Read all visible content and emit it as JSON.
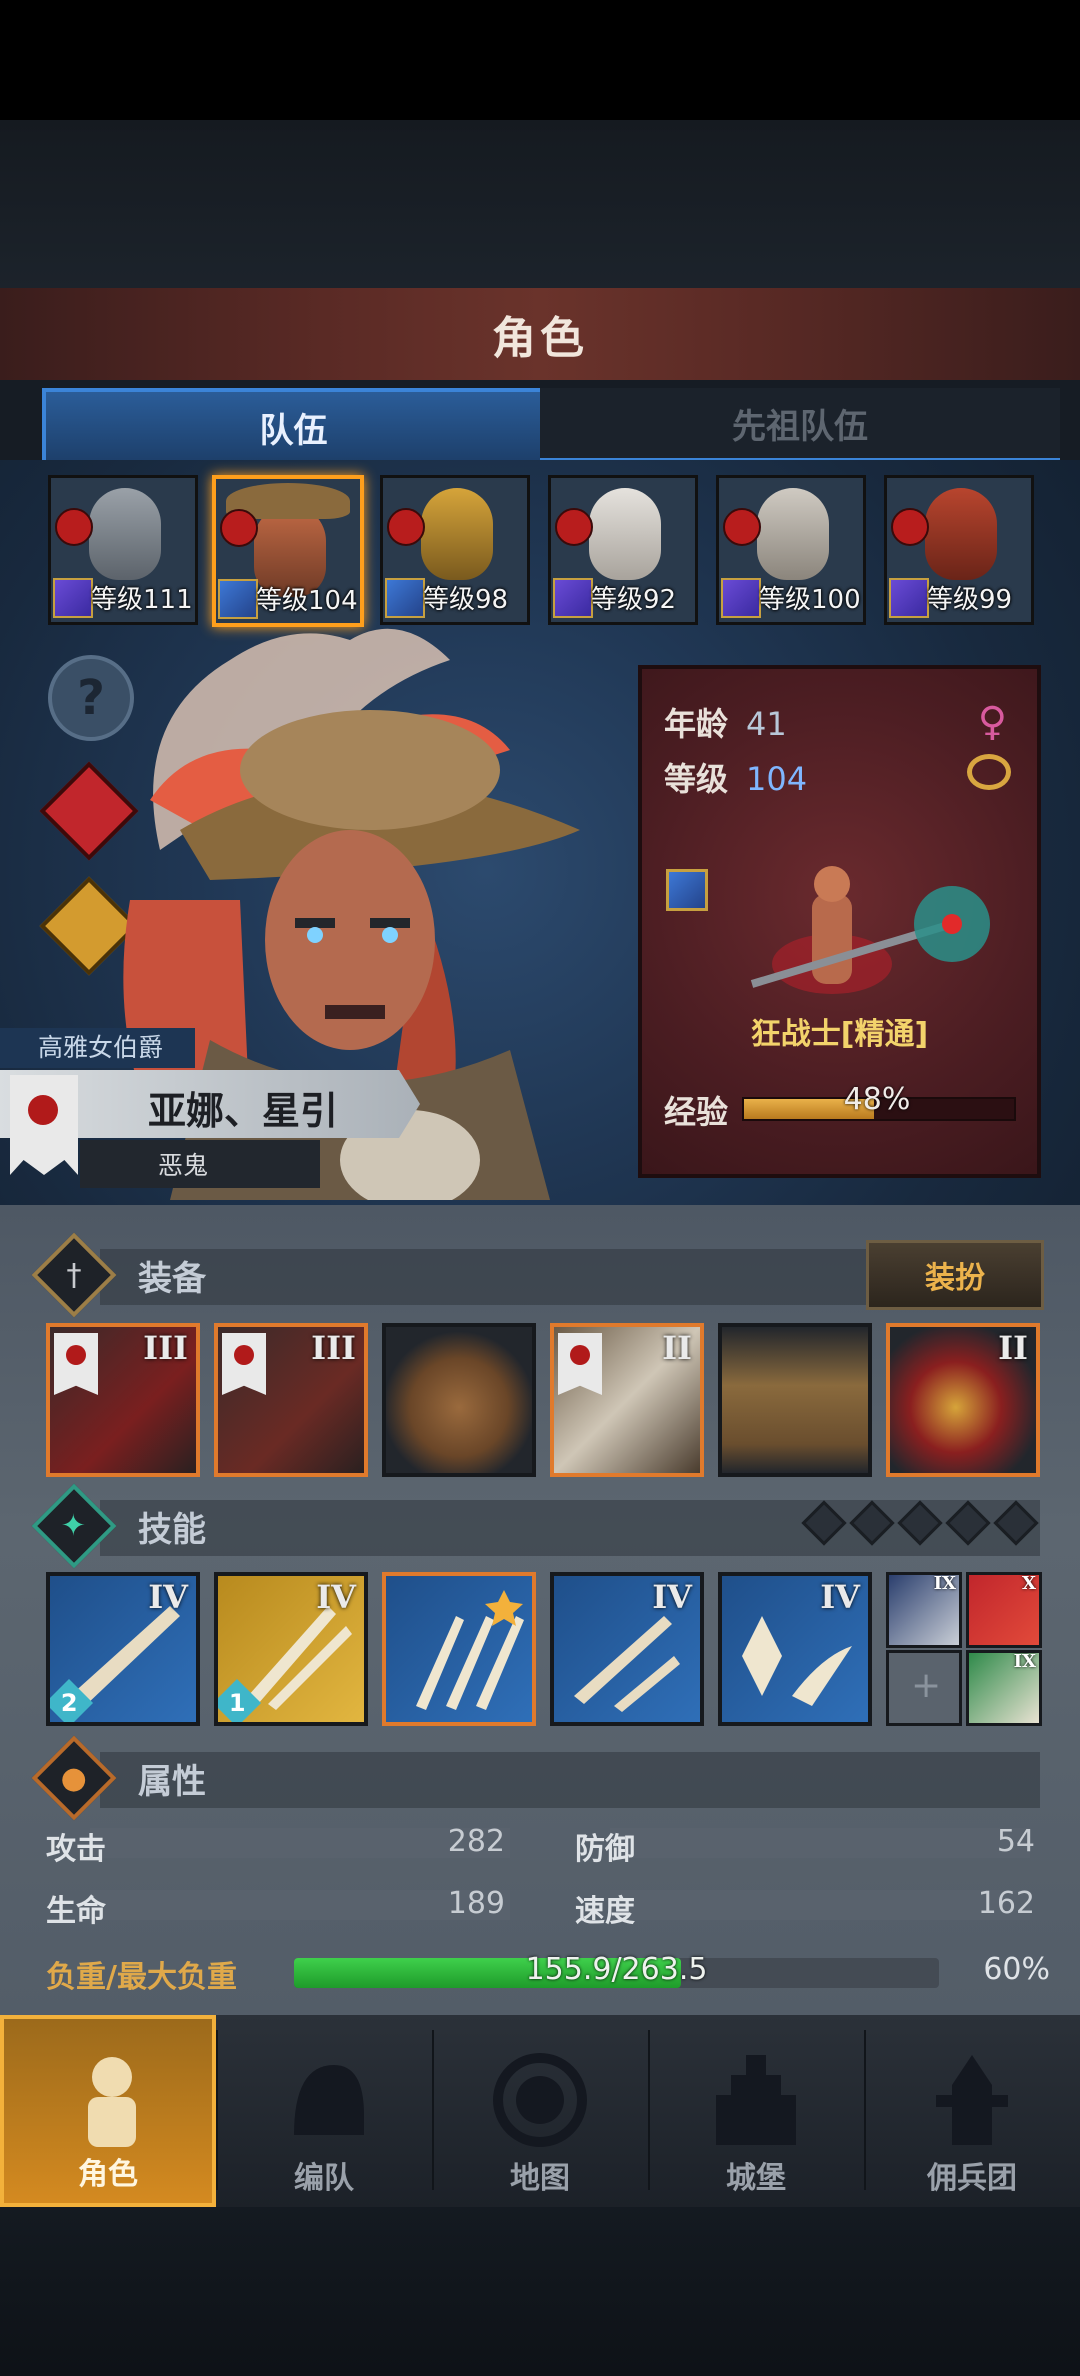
{
  "header": {
    "title": "角色"
  },
  "tabs": [
    {
      "label": "队伍",
      "active": true
    },
    {
      "label": "先祖队伍",
      "active": false
    }
  ],
  "roster": [
    {
      "level_label": "等级111",
      "selected": false,
      "weapon": "staff"
    },
    {
      "level_label": "等级104",
      "selected": true,
      "weapon": "sword"
    },
    {
      "level_label": "等级98",
      "selected": false,
      "weapon": "sword"
    },
    {
      "level_label": "等级92",
      "selected": false,
      "weapon": "staff"
    },
    {
      "level_label": "等级100",
      "selected": false,
      "weapon": "staff"
    },
    {
      "level_label": "等级99",
      "selected": false,
      "weapon": "staff"
    }
  ],
  "hero": {
    "subtitle": "高雅女伯爵",
    "name": "亚娜、星引",
    "trait": "恶鬼"
  },
  "info": {
    "age_label": "年龄",
    "age_value": "41",
    "level_label": "等级",
    "level_value": "104",
    "class_name": "狂战士[精通]",
    "exp_label": "经验",
    "exp_text": "48%",
    "exp_progress": 0.48
  },
  "equipment": {
    "label": "装备",
    "dress_button": "装扮",
    "slots": [
      {
        "rank": "III",
        "banner": true,
        "highlight": true
      },
      {
        "rank": "III",
        "banner": true,
        "highlight": true
      },
      {
        "rank": "",
        "banner": false,
        "highlight": false
      },
      {
        "rank": "II",
        "banner": true,
        "highlight": true
      },
      {
        "rank": "",
        "banner": false,
        "highlight": false
      },
      {
        "rank": "II",
        "banner": false,
        "highlight": true
      }
    ]
  },
  "skills": {
    "label": "技能",
    "main": [
      {
        "rank": "IV",
        "count": "2"
      },
      {
        "rank": "IV",
        "count": "1"
      },
      {
        "rank": "",
        "count": ""
      },
      {
        "rank": "IV",
        "count": ""
      },
      {
        "rank": "IV",
        "count": ""
      }
    ],
    "mini": [
      {
        "rank": "IX"
      },
      {
        "rank": "X"
      },
      {
        "rank": ""
      },
      {
        "rank": "IX"
      }
    ]
  },
  "attributes": {
    "label": "属性",
    "attack_label": "攻击",
    "attack_value": "282",
    "defense_label": "防御",
    "defense_value": "54",
    "hp_label": "生命",
    "hp_value": "189",
    "speed_label": "速度",
    "speed_value": "162",
    "burden_label": "负重/最大负重",
    "burden_text": "155.9/263.5",
    "burden_pct": "60%",
    "burden_progress": 0.6
  },
  "nav": [
    {
      "label": "角色",
      "active": true
    },
    {
      "label": "编队",
      "active": false
    },
    {
      "label": "地图",
      "active": false
    },
    {
      "label": "城堡",
      "active": false
    },
    {
      "label": "佣兵团",
      "active": false
    }
  ],
  "colors": {
    "accent": "#3b84d8",
    "selected": "#ff9f1c",
    "burden": "#2fbf3c",
    "exp": "#d99a32"
  }
}
